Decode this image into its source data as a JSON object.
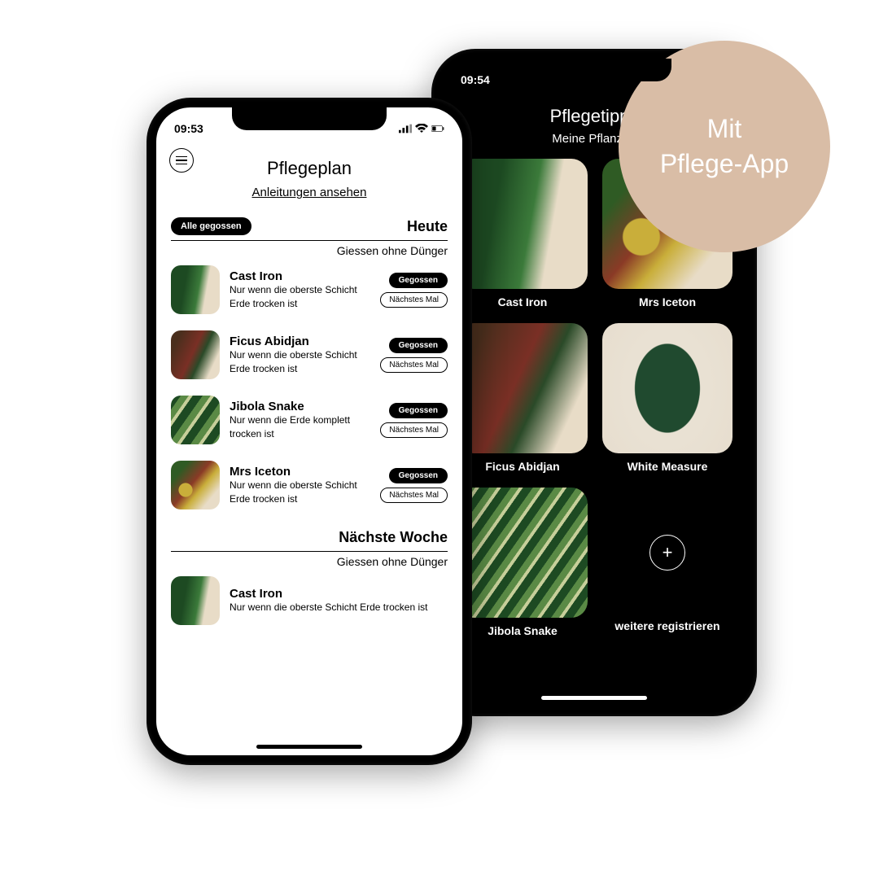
{
  "badge": {
    "line1": "Mit",
    "line2": "Pflege-App"
  },
  "back": {
    "time": "09:54",
    "title": "Pflegetipps",
    "subtitle": "Meine Pflanzen",
    "items": [
      {
        "label": "Cast Iron"
      },
      {
        "label": "Mrs Iceton"
      },
      {
        "label": "Ficus Abidjan"
      },
      {
        "label": "White Measure"
      },
      {
        "label": "Jibola Snake"
      },
      {
        "label": "weitere registrieren"
      }
    ]
  },
  "front": {
    "time": "09:53",
    "title": "Pflegeplan",
    "link": "Anleitungen ansehen",
    "allButton": "Alle gegossen",
    "today": {
      "title": "Heute",
      "subtitle": "Giessen ohne Dünger",
      "rows": [
        {
          "name": "Cast Iron",
          "desc": "Nur wenn die oberste Schicht Erde trocken ist",
          "btn1": "Gegossen",
          "btn2": "Nächstes Mal"
        },
        {
          "name": "Ficus Abidjan",
          "desc": "Nur wenn die oberste Schicht Erde trocken ist",
          "btn1": "Gegossen",
          "btn2": "Nächstes Mal"
        },
        {
          "name": "Jibola Snake",
          "desc": "Nur wenn die Erde komplett trocken ist",
          "btn1": "Gegossen",
          "btn2": "Nächstes Mal"
        },
        {
          "name": "Mrs Iceton",
          "desc": "Nur wenn die oberste Schicht Erde trocken ist",
          "btn1": "Gegossen",
          "btn2": "Nächstes Mal"
        }
      ]
    },
    "nextweek": {
      "title": "Nächste Woche",
      "subtitle": "Giessen ohne Dünger",
      "rows": [
        {
          "name": "Cast Iron",
          "desc": "Nur wenn die oberste Schicht Erde trocken ist"
        }
      ]
    }
  }
}
